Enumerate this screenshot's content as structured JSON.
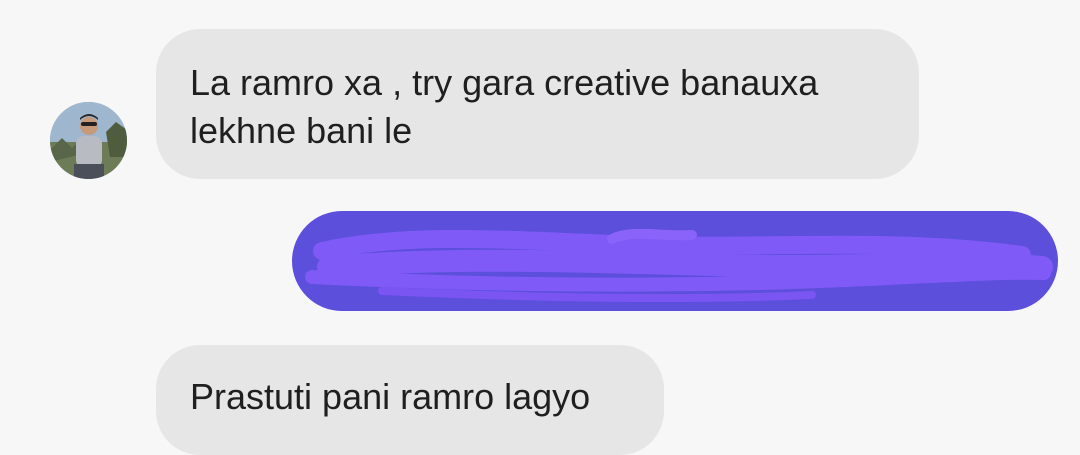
{
  "messages": [
    {
      "direction": "incoming",
      "lines": [
        "La ramro xa , try gara creative banauxa",
        "lekhne bani le"
      ]
    },
    {
      "direction": "outgoing",
      "text": "",
      "redacted": true,
      "bubble_color": "#5b4fdc",
      "scribble_color": "#7f5af6"
    },
    {
      "direction": "incoming",
      "lines": [
        "Prastuti pani ramro lagyo"
      ]
    }
  ],
  "colors": {
    "background": "#f7f7f7",
    "incoming_bubble": "#e6e6e6",
    "text": "#1f1f1f"
  },
  "avatar": {
    "icon": "person-photo-avatar"
  }
}
